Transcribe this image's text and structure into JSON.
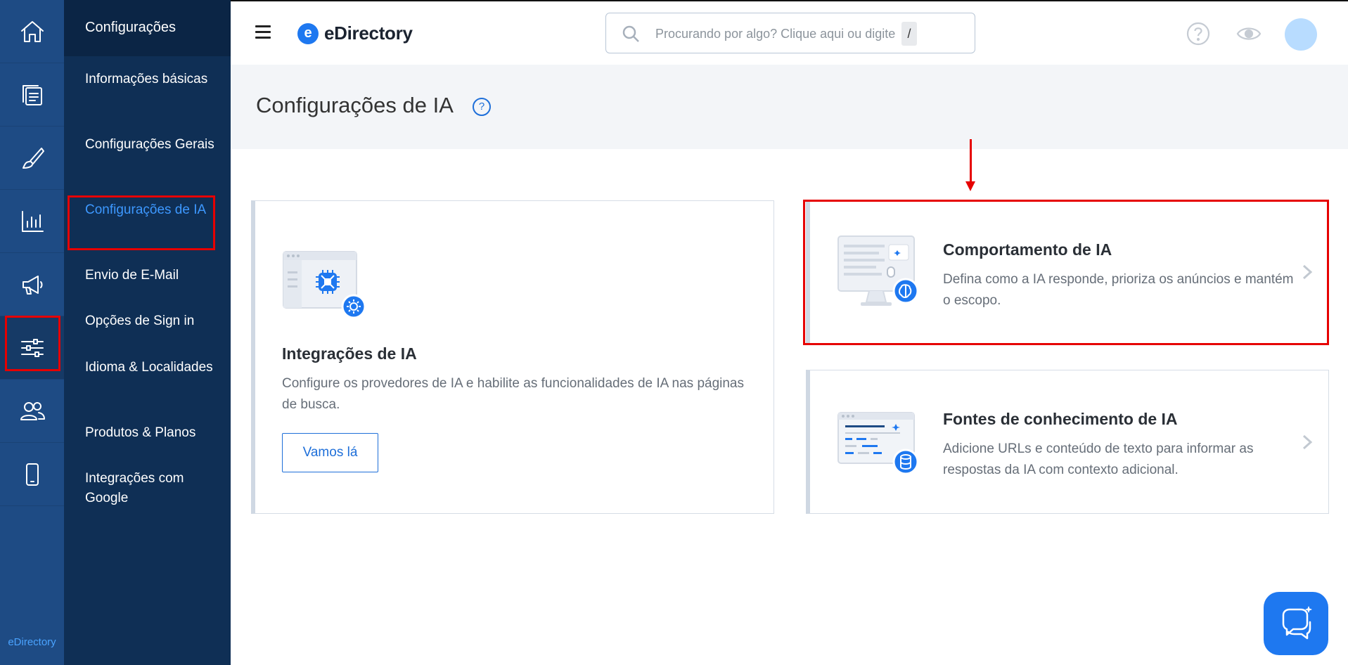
{
  "rail": {
    "brand": "eDirectory",
    "items": [
      {
        "name": "home-icon"
      },
      {
        "name": "content-icon"
      },
      {
        "name": "design-brush-icon"
      },
      {
        "name": "reports-chart-icon"
      },
      {
        "name": "promote-megaphone-icon"
      },
      {
        "name": "settings-sliders-icon"
      },
      {
        "name": "users-icon"
      },
      {
        "name": "mobile-icon"
      }
    ]
  },
  "submenu": {
    "title": "Configurações",
    "items": [
      {
        "label": "Informações básicas"
      },
      {
        "label": "Configurações Gerais"
      },
      {
        "label": "Configurações de IA"
      },
      {
        "label": "Envio de E-Mail"
      },
      {
        "label": "Opções de Sign in"
      },
      {
        "label": "Idioma & Localidades"
      },
      {
        "label": "Produtos & Planos"
      },
      {
        "label": "Integrações com Google"
      }
    ]
  },
  "topbar": {
    "logo_mark": "e",
    "logo_text": "eDirectory",
    "search_placeholder": "Procurando por algo? Clique aqui ou digite",
    "search_shortcut": "/"
  },
  "page": {
    "title": "Configurações de IA",
    "help": "?"
  },
  "cards": {
    "integrations": {
      "title": "Integrações de IA",
      "description": "Configure os provedores de IA e habilite as funcionalidades de IA nas páginas de busca.",
      "button": "Vamos lá"
    },
    "behavior": {
      "title": "Comportamento de IA",
      "description": "Defina como a IA responde, prioriza os anúncios e mantém o escopo."
    },
    "knowledge": {
      "title": "Fontes de conhecimento de IA",
      "description": "Adicione URLs e conteúdo de texto para informar as respostas da IA com contexto adicional."
    }
  },
  "colors": {
    "accent": "#1e78f0",
    "highlight": "#e60000",
    "rail": "#1e4b84",
    "submenu": "#0f2f55"
  }
}
